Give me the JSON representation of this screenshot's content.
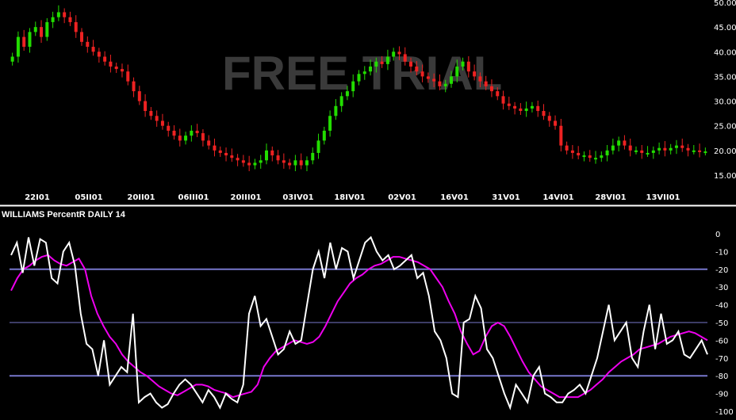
{
  "chart_data": [
    {
      "type": "candlestick",
      "watermark": "FREE TRIAL",
      "x_ticks": [
        "22I01",
        "05II01",
        "20II01",
        "06III01",
        "20III01",
        "03IV01",
        "18IV01",
        "02V01",
        "16V01",
        "31V01",
        "14VI01",
        "28VI01",
        "13VII01"
      ],
      "y_ticks": [
        "50.00",
        "45.00",
        "40.00",
        "35.00",
        "30.00",
        "25.00",
        "20.00",
        "15.00"
      ],
      "y_tick_values": [
        50,
        45,
        40,
        35,
        30,
        25,
        20,
        15
      ],
      "ylim": [
        12.5,
        50
      ],
      "grid": false,
      "colors": {
        "up": "#22dd00",
        "down": "#ee2222",
        "background": "#000000",
        "axis_text": "#ffffff"
      },
      "closes": [
        39,
        43,
        41,
        44,
        45,
        43,
        46,
        47,
        48,
        47,
        46,
        44,
        42,
        41,
        40,
        39,
        38,
        37,
        36.5,
        36,
        34,
        32,
        30,
        28,
        27,
        26,
        25,
        24,
        23,
        22,
        23,
        24,
        23.5,
        22,
        21,
        20,
        19.5,
        19,
        18.5,
        18,
        17.5,
        17,
        17.5,
        18,
        20,
        19,
        18,
        17.5,
        17,
        18,
        17,
        18,
        19.5,
        22,
        24,
        27,
        29,
        31,
        32,
        34,
        35.5,
        36,
        37,
        38,
        37.5,
        39,
        40,
        39.5,
        38,
        37,
        36,
        35,
        34.5,
        34,
        33,
        33.5,
        35,
        37,
        38,
        36,
        35,
        34,
        33,
        32,
        31,
        29.5,
        29,
        28.5,
        28,
        28.5,
        29,
        28,
        27,
        26,
        25,
        21,
        20,
        19.5,
        19,
        19,
        18.5,
        18.5,
        19,
        20,
        21,
        22,
        21,
        20,
        20,
        19.5,
        19.5,
        20,
        20.5,
        20,
        20.5,
        21,
        20.5,
        20,
        20,
        19.8,
        19.8
      ]
    },
    {
      "type": "line",
      "title": "WILLIAMS PercentR DAILY 14",
      "y_ticks": [
        "0",
        "-10",
        "-20",
        "-30",
        "-40",
        "-50",
        "-60",
        "-70",
        "-80",
        "-90",
        "-100"
      ],
      "y_tick_values": [
        0,
        -10,
        -20,
        -30,
        -40,
        -50,
        -60,
        -70,
        -80,
        -90,
        -100
      ],
      "ylim": [
        -100,
        0
      ],
      "reference_lines": [
        -20,
        -50,
        -80
      ],
      "grid": false,
      "colors": {
        "percent_r": "#ffffff",
        "signal": "#ee00ee",
        "reference": "#7777cc"
      },
      "series": [
        {
          "role": "percent_r",
          "values": [
            -12,
            -5,
            -22,
            -2,
            -18,
            -3,
            -5,
            -25,
            -28,
            -10,
            -5,
            -18,
            -45,
            -62,
            -65,
            -80,
            -60,
            -85,
            -80,
            -75,
            -78,
            -45,
            -95,
            -92,
            -90,
            -95,
            -98,
            -96,
            -90,
            -85,
            -82,
            -85,
            -90,
            -95,
            -88,
            -92,
            -98,
            -90,
            -93,
            -95,
            -85,
            -45,
            -35,
            -52,
            -48,
            -58,
            -68,
            -65,
            -55,
            -62,
            -60,
            -40,
            -20,
            -10,
            -25,
            -5,
            -20,
            -8,
            -10,
            -25,
            -15,
            -5,
            -2,
            -10,
            -15,
            -12,
            -20,
            -18,
            -15,
            -12,
            -25,
            -22,
            -35,
            -55,
            -60,
            -70,
            -90,
            -92,
            -50,
            -48,
            -35,
            -42,
            -65,
            -70,
            -80,
            -90,
            -98,
            -85,
            -90,
            -95,
            -80,
            -75,
            -90,
            -92,
            -95,
            -95,
            -90,
            -88,
            -85,
            -90,
            -80,
            -70,
            -55,
            -40,
            -60,
            -55,
            -50,
            -70,
            -75,
            -55,
            -40,
            -65,
            -45,
            -62,
            -60,
            -55,
            -68,
            -70,
            -65,
            -60,
            -68
          ]
        },
        {
          "role": "signal",
          "values": [
            -32,
            -25,
            -20,
            -18,
            -15,
            -13,
            -12,
            -15,
            -17,
            -18,
            -16,
            -14,
            -20,
            -35,
            -45,
            -52,
            -58,
            -62,
            -68,
            -72,
            -75,
            -78,
            -80,
            -83,
            -86,
            -88,
            -90,
            -91,
            -89,
            -87,
            -85,
            -85,
            -86,
            -88,
            -89,
            -90,
            -92,
            -91,
            -90,
            -89,
            -85,
            -75,
            -70,
            -66,
            -64,
            -62,
            -60,
            -61,
            -62,
            -61,
            -58,
            -52,
            -45,
            -38,
            -33,
            -28,
            -25,
            -23,
            -20,
            -18,
            -17,
            -15,
            -13,
            -13,
            -14,
            -15,
            -16,
            -18,
            -20,
            -25,
            -30,
            -38,
            -45,
            -55,
            -62,
            -68,
            -66,
            -58,
            -52,
            -50,
            -52,
            -58,
            -65,
            -72,
            -78,
            -82,
            -86,
            -88,
            -90,
            -92,
            -92,
            -92,
            -92,
            -90,
            -88,
            -85,
            -82,
            -78,
            -75,
            -72,
            -70,
            -68,
            -65,
            -64,
            -63,
            -62,
            -60,
            -58,
            -57,
            -56,
            -55,
            -56,
            -58,
            -60
          ]
        }
      ]
    }
  ]
}
